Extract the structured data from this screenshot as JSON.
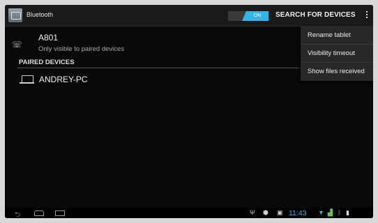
{
  "actionbar": {
    "title": "Bluetooth",
    "toggle_label": "ON",
    "search_label": "SEARCH FOR DEVICES",
    "overflow_icon": "more-vert-icon"
  },
  "this_device": {
    "icon": "phone-icon",
    "name": "A801",
    "subtitle": "Only visible to paired devices"
  },
  "paired_section": {
    "header": "PAIRED DEVICES",
    "devices": [
      {
        "icon": "laptop-icon",
        "name": "ANDREY-PC",
        "settings_icon": "settings-icon"
      }
    ]
  },
  "overflow_menu": {
    "items": [
      {
        "label": "Rename tablet"
      },
      {
        "label": "Visibility timeout"
      },
      {
        "label": "Show files received"
      }
    ]
  },
  "statusbar": {
    "time": "11:43",
    "icons": [
      "usb-icon",
      "android-icon",
      "image-icon",
      "wifi-icon",
      "signal-icon",
      "bluetooth-icon",
      "battery-icon"
    ]
  },
  "colors": {
    "accent": "#33b5e5",
    "background": "#090909",
    "menu_background": "#282828"
  }
}
